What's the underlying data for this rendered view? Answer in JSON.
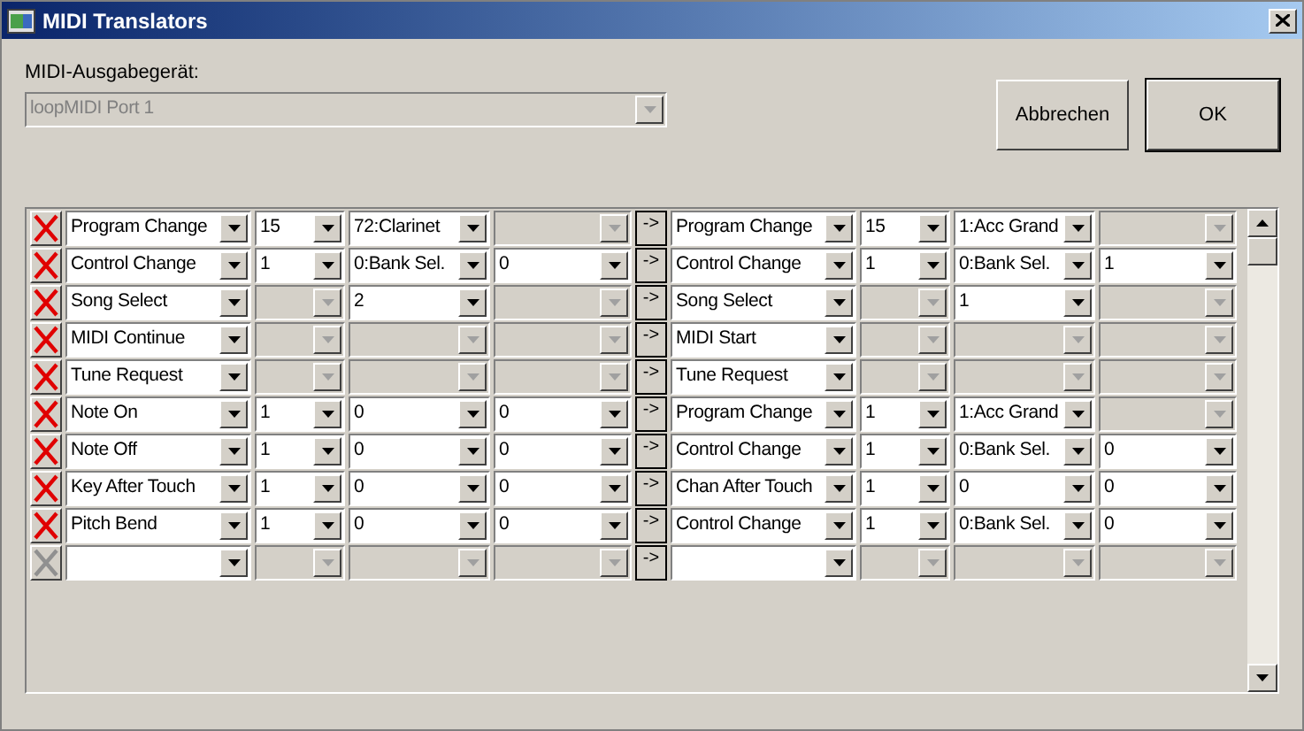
{
  "window": {
    "title": "MIDI Translators"
  },
  "output_device": {
    "label": "MIDI-Ausgabegerät:",
    "value": "loopMIDI Port 1",
    "disabled": true
  },
  "buttons": [
    {
      "label": "Abbrechen",
      "default": false
    },
    {
      "label": "OK",
      "default": true
    }
  ],
  "rows": [
    {
      "delete_disabled": false,
      "arrow": "->",
      "input": [
        {
          "value": "Program Change",
          "disabled": false
        },
        {
          "value": "15",
          "disabled": false
        },
        {
          "value": "72:Clarinet",
          "disabled": false
        },
        {
          "disabled": true
        }
      ],
      "output": [
        {
          "value": "Program Change",
          "disabled": false
        },
        {
          "value": "15",
          "disabled": false
        },
        {
          "value": "1:Acc Grand",
          "disabled": false
        },
        {
          "disabled": true
        }
      ]
    },
    {
      "delete_disabled": false,
      "arrow": "->",
      "input": [
        {
          "value": "Control Change",
          "disabled": false
        },
        {
          "value": "1",
          "disabled": false
        },
        {
          "value": "0:Bank Sel.",
          "disabled": false
        },
        {
          "value": "0",
          "disabled": false
        }
      ],
      "output": [
        {
          "value": "Control Change",
          "disabled": false
        },
        {
          "value": "1",
          "disabled": false
        },
        {
          "value": "0:Bank Sel.",
          "disabled": false
        },
        {
          "value": "1",
          "disabled": false
        }
      ]
    },
    {
      "delete_disabled": false,
      "arrow": "->",
      "input": [
        {
          "value": "Song Select",
          "disabled": false
        },
        {
          "disabled": true
        },
        {
          "value": "2",
          "disabled": false
        },
        {
          "disabled": true
        }
      ],
      "output": [
        {
          "value": "Song Select",
          "disabled": false
        },
        {
          "disabled": true
        },
        {
          "value": "1",
          "disabled": false
        },
        {
          "disabled": true
        }
      ]
    },
    {
      "delete_disabled": false,
      "arrow": "->",
      "input": [
        {
          "value": "MIDI Continue",
          "disabled": false
        },
        {
          "disabled": true
        },
        {
          "disabled": true
        },
        {
          "disabled": true
        }
      ],
      "output": [
        {
          "value": "MIDI Start",
          "disabled": false
        },
        {
          "disabled": true
        },
        {
          "disabled": true
        },
        {
          "disabled": true
        }
      ]
    },
    {
      "delete_disabled": false,
      "arrow": "->",
      "input": [
        {
          "value": "Tune Request",
          "disabled": false
        },
        {
          "disabled": true
        },
        {
          "disabled": true
        },
        {
          "disabled": true
        }
      ],
      "output": [
        {
          "value": "Tune Request",
          "disabled": false
        },
        {
          "disabled": true
        },
        {
          "disabled": true
        },
        {
          "disabled": true
        }
      ]
    },
    {
      "delete_disabled": false,
      "arrow": "->",
      "input": [
        {
          "value": "Note On",
          "disabled": false
        },
        {
          "value": "1",
          "disabled": false
        },
        {
          "value": "0",
          "disabled": false
        },
        {
          "value": "0",
          "disabled": false
        }
      ],
      "output": [
        {
          "value": "Program Change",
          "disabled": false
        },
        {
          "value": "1",
          "disabled": false
        },
        {
          "value": "1:Acc Grand",
          "disabled": false
        },
        {
          "disabled": true
        }
      ]
    },
    {
      "delete_disabled": false,
      "arrow": "->",
      "input": [
        {
          "value": "Note Off",
          "disabled": false
        },
        {
          "value": "1",
          "disabled": false
        },
        {
          "value": "0",
          "disabled": false
        },
        {
          "value": "0",
          "disabled": false
        }
      ],
      "output": [
        {
          "value": "Control Change",
          "disabled": false
        },
        {
          "value": "1",
          "disabled": false
        },
        {
          "value": "0:Bank Sel.",
          "disabled": false
        },
        {
          "value": "0",
          "disabled": false
        }
      ]
    },
    {
      "delete_disabled": false,
      "arrow": "->",
      "input": [
        {
          "value": "Key After Touch",
          "disabled": false
        },
        {
          "value": "1",
          "disabled": false
        },
        {
          "value": "0",
          "disabled": false
        },
        {
          "value": "0",
          "disabled": false
        }
      ],
      "output": [
        {
          "value": "Chan After Touch",
          "disabled": false
        },
        {
          "value": "1",
          "disabled": false
        },
        {
          "value": "0",
          "disabled": false
        },
        {
          "value": "0",
          "disabled": false
        }
      ]
    },
    {
      "delete_disabled": false,
      "arrow": "->",
      "input": [
        {
          "value": "Pitch Bend",
          "disabled": false
        },
        {
          "value": "1",
          "disabled": false
        },
        {
          "value": "0",
          "disabled": false
        },
        {
          "value": "0",
          "disabled": false
        }
      ],
      "output": [
        {
          "value": "Control Change",
          "disabled": false
        },
        {
          "value": "1",
          "disabled": false
        },
        {
          "value": "0:Bank Sel.",
          "disabled": false
        },
        {
          "value": "0",
          "disabled": false
        }
      ]
    },
    {
      "delete_disabled": true,
      "arrow": "->",
      "input": [
        {
          "disabled": false
        },
        {
          "disabled": true
        },
        {
          "disabled": true
        },
        {
          "disabled": true
        }
      ],
      "output": [
        {
          "disabled": false
        },
        {
          "disabled": true
        },
        {
          "disabled": true
        },
        {
          "disabled": true
        }
      ]
    }
  ]
}
